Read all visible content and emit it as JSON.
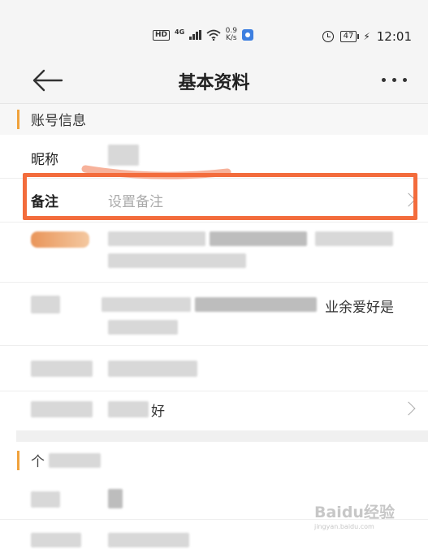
{
  "status_bar": {
    "hd": "HD",
    "network": "4G",
    "speed_value": "0.9",
    "speed_unit": "K/s",
    "battery": "47",
    "time": "12:01"
  },
  "nav": {
    "title": "基本资料"
  },
  "sections": {
    "account": {
      "label": "账号信息"
    },
    "second": {
      "label": "个"
    }
  },
  "rows": {
    "nickname": {
      "key": "昵称"
    },
    "remark": {
      "key": "备注",
      "placeholder": "设置备注"
    },
    "hobby_tail": {
      "value": "好"
    },
    "heart_tail": {
      "value": "业余爱好是"
    }
  },
  "watermark": {
    "brand": "Baidu经验",
    "url": "jingyan.baidu.com"
  },
  "colors": {
    "accent_bar": "#f0a23c",
    "highlight": "#f36c3c",
    "header_bg": "#f5f5f5"
  }
}
